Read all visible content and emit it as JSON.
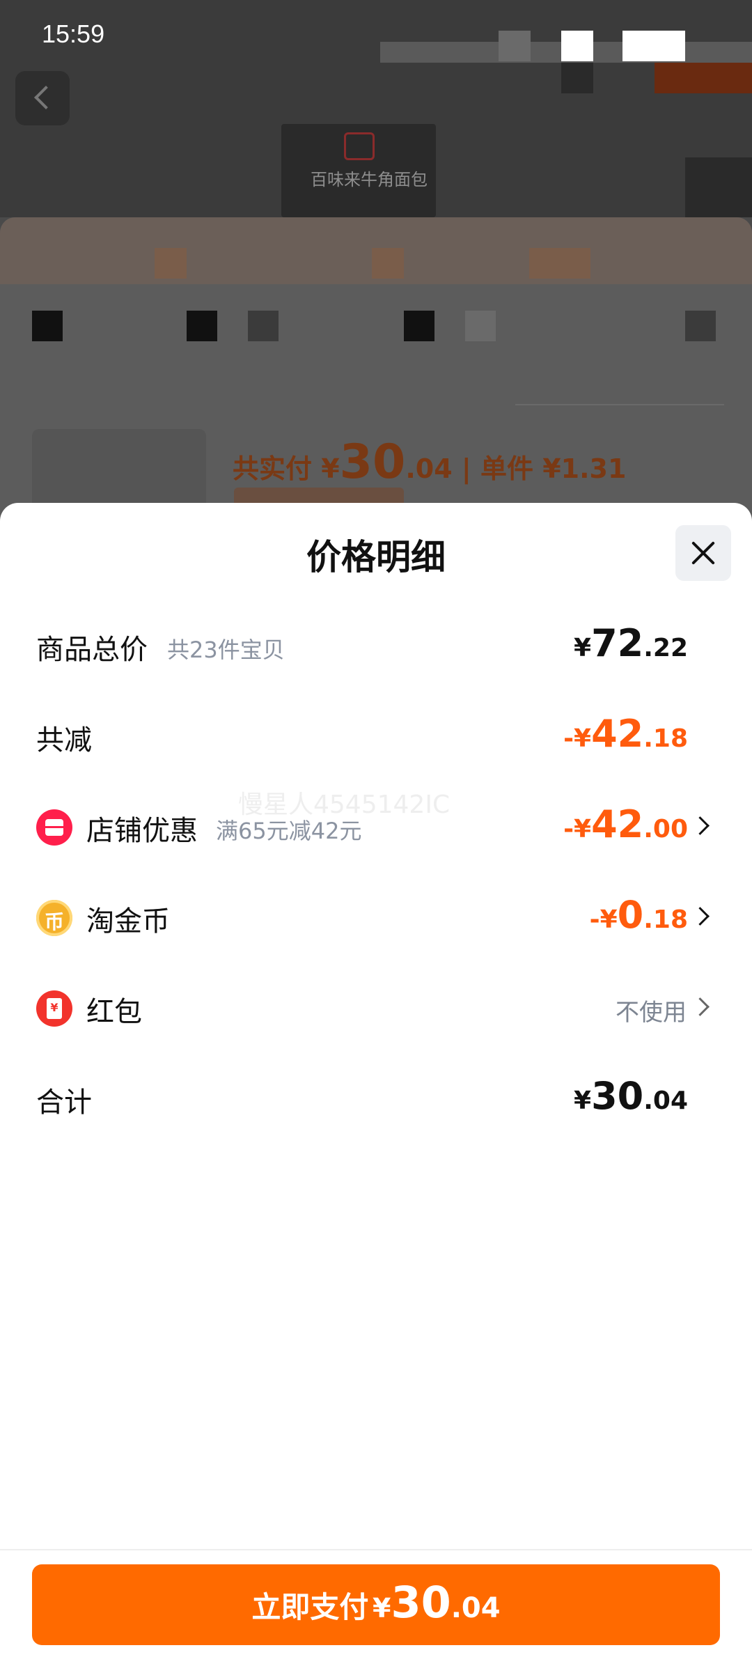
{
  "status_bar": {
    "time": "15:59"
  },
  "background": {
    "banner_text": "百味来牛角面包",
    "pay_summary": "共实付 ¥",
    "pay_int": "30",
    "pay_dec": ".04",
    "unit_price": "| 单件 ¥1.31"
  },
  "sheet": {
    "title": "价格明细",
    "rows": {
      "goods_total": {
        "label": "商品总价",
        "note": "共23件宝贝",
        "currency": "¥",
        "int": "72",
        "dec": ".22"
      },
      "total_discount": {
        "label": "共减",
        "currency": "-¥",
        "int": "42",
        "dec": ".18"
      },
      "shop_discount": {
        "label": "店铺优惠",
        "note": "满65元减42元",
        "currency": "-¥",
        "int": "42",
        "dec": ".00"
      },
      "taojinbi": {
        "label": "淘金币",
        "icon_glyph": "币",
        "currency": "-¥",
        "int": "0",
        "dec": ".18"
      },
      "red_packet": {
        "label": "红包",
        "icon_glyph": "¥",
        "value": "不使用"
      },
      "total": {
        "label": "合计",
        "currency": "¥",
        "int": "30",
        "dec": ".04"
      }
    },
    "watermark": "慢星人4545142IC"
  },
  "pay_button": {
    "label": "立即支付",
    "currency": "¥",
    "int": "30",
    "dec": ".04"
  },
  "colors": {
    "accent": "#ff6a00",
    "discount": "#ff5b0d",
    "muted": "#8b93a1"
  },
  "icons": [
    "back-arrow-icon",
    "close-icon",
    "shop-icon",
    "coin-icon",
    "red-packet-icon",
    "chevron-right-icon"
  ]
}
